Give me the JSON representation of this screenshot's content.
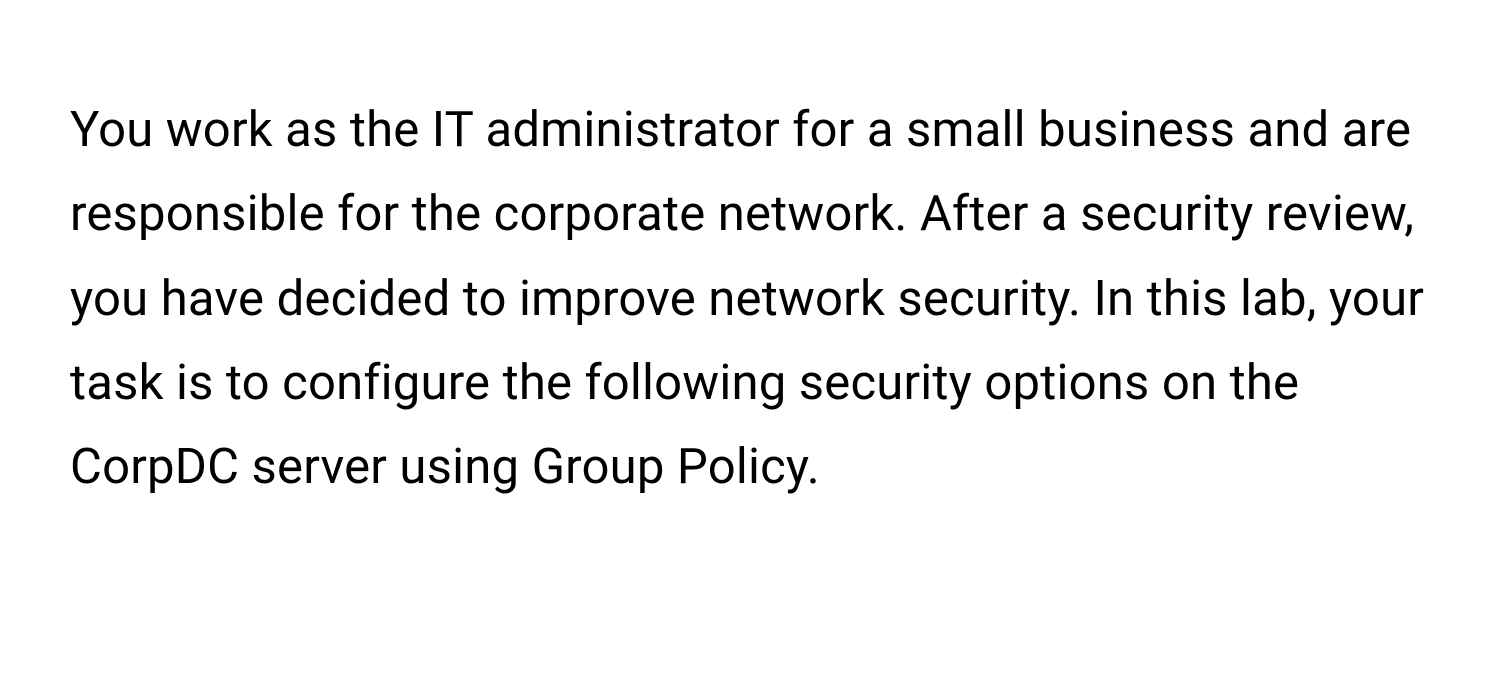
{
  "content": {
    "paragraph": "You work as the IT administrator for a small business and are responsible for the corporate network. After a security review, you have decided to improve network security. In this lab, your task is to configure the following security options on the CorpDC server using Group Policy."
  }
}
